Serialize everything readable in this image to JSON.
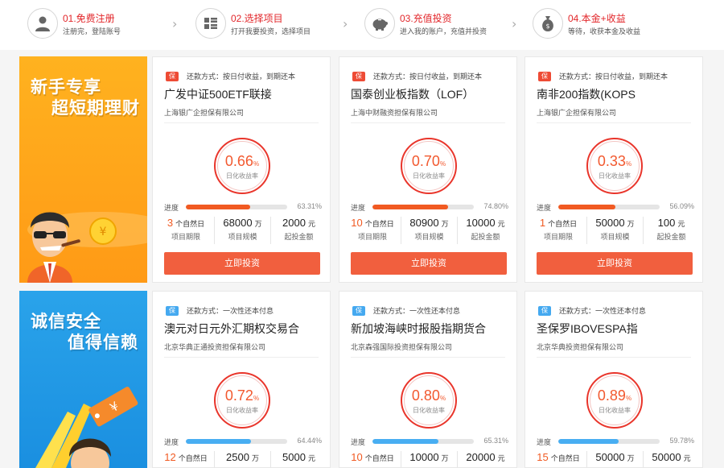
{
  "steps": [
    {
      "title": "01.免费注册",
      "desc": "注册完，登陆账号",
      "icon": "user-icon"
    },
    {
      "title": "02.选择项目",
      "desc": "打开我要投资，选择项目",
      "icon": "grid-list-icon"
    },
    {
      "title": "03.充值投资",
      "desc": "进入我的账户，充值并投资",
      "icon": "piggy-bank-icon"
    },
    {
      "title": "04.本金+收益",
      "desc": "等待，收获本金及收益",
      "icon": "money-bag-icon"
    }
  ],
  "banners": {
    "novice": {
      "line1": "新手专享",
      "line2": "超短期理财"
    },
    "trust": {
      "line1": "诚信安全",
      "line2": "值得信赖"
    }
  },
  "labels": {
    "rate_label": "日化收益率",
    "progress": "进度",
    "term_label": "项目期限",
    "scale_label": "项目规模",
    "min_label": "起投金额",
    "term_unit": "个自然日",
    "scale_unit": "万",
    "min_unit": "元",
    "rate_suffix": "%",
    "invest_button": "立即投资"
  },
  "colors": {
    "accent": "#f15a22",
    "button": "#f15f3e",
    "tag_red": "#ee4b35",
    "tag_blue": "#45a9f0"
  },
  "products": [
    {
      "tag": "保",
      "tag_color": "red",
      "repay": "还款方式：按日付收益，到期还本",
      "name": "广发中证500ETF联接",
      "guarantor": "上海银广企担保有限公司",
      "rate": "0.66",
      "progress": 63.31,
      "progress_text": "63.31%",
      "term": "3",
      "scale": "68000",
      "min": "2000"
    },
    {
      "tag": "保",
      "tag_color": "red",
      "repay": "还款方式：按日付收益，到期还本",
      "name": "国泰创业板指数（LOF）",
      "guarantor": "上海中财融资担保有限公司",
      "rate": "0.70",
      "progress": 74.8,
      "progress_text": "74.80%",
      "term": "10",
      "scale": "80900",
      "min": "10000"
    },
    {
      "tag": "保",
      "tag_color": "red",
      "repay": "还款方式：按日付收益，到期还本",
      "name": "南非200指数(KOPS",
      "guarantor": "上海银广企担保有限公司",
      "rate": "0.33",
      "progress": 56.09,
      "progress_text": "56.09%",
      "term": "1",
      "scale": "50000",
      "min": "100"
    },
    {
      "tag": "保",
      "tag_color": "blue",
      "repay": "还款方式：一次性还本付息",
      "name": "澳元对日元外汇期权交易合",
      "guarantor": "北京华典正通投资担保有限公司",
      "rate": "0.72",
      "progress": 64.44,
      "progress_text": "64.44%",
      "term": "12",
      "scale": "2500",
      "min": "5000"
    },
    {
      "tag": "保",
      "tag_color": "blue",
      "repay": "还款方式：一次性还本付息",
      "name": "新加坡海峡时报股指期货合",
      "guarantor": "北京森强国际投资担保有限公司",
      "rate": "0.80",
      "progress": 65.31,
      "progress_text": "65.31%",
      "term": "10",
      "scale": "10000",
      "min": "20000"
    },
    {
      "tag": "保",
      "tag_color": "blue",
      "repay": "还款方式：一次性还本付息",
      "name": "圣保罗IBOVESPA指",
      "guarantor": "北京华典投资担保有限公司",
      "rate": "0.89",
      "progress": 59.78,
      "progress_text": "59.78%",
      "term": "15",
      "scale": "50000",
      "min": "50000"
    }
  ]
}
